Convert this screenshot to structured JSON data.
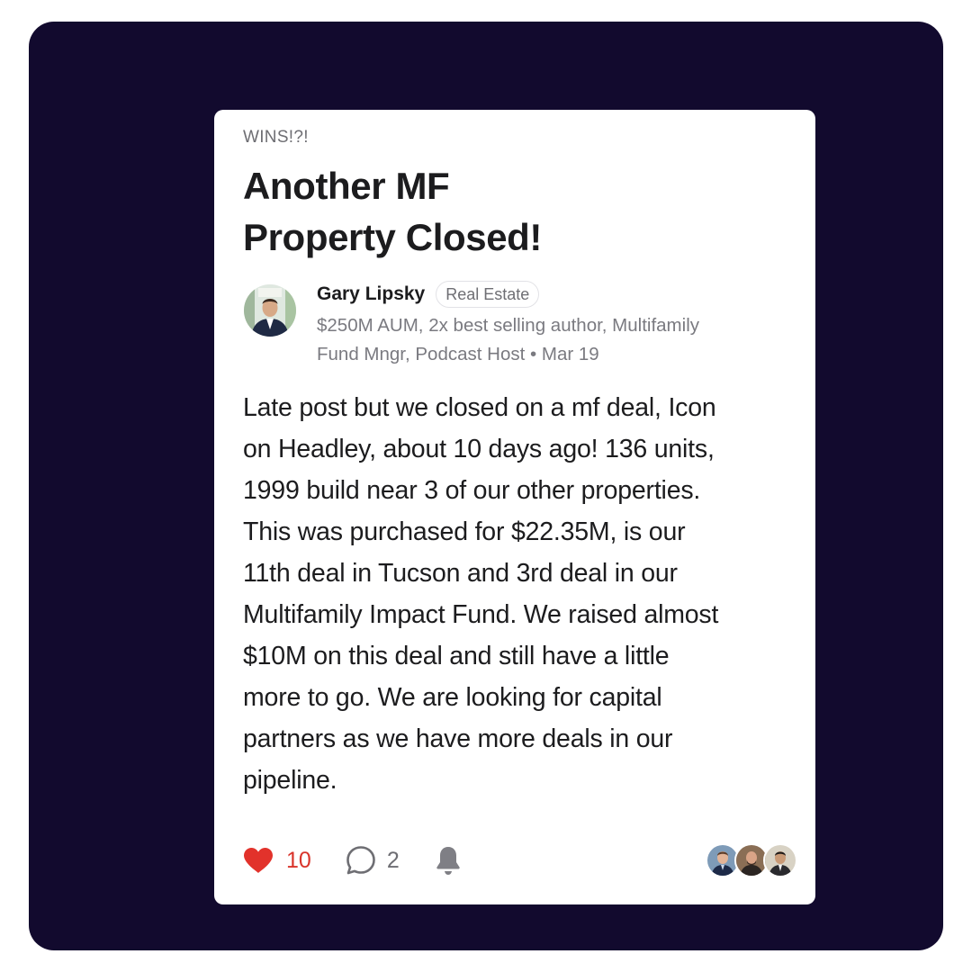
{
  "post": {
    "category": "WINS!?!",
    "title_line1": "Another MF",
    "title_line2": "Property Closed!",
    "author": {
      "name": "Gary Lipsky",
      "tag": "Real Estate",
      "bio_line1": "$250M AUM, 2x best selling author, Multifamily",
      "bio_line2": "Fund Mngr, Podcast Host",
      "separator": "•",
      "date": "Mar 19"
    },
    "body": [
      "Late post but we closed on a mf deal, Icon",
      "on Headley, about 10 days ago! 136 units,",
      "1999 build near 3 of our other properties.",
      "This was purchased for $22.35M, is our",
      "11th deal in Tucson and 3rd deal in our",
      "Multifamily Impact Fund. We raised almost",
      "$10M on this deal and still have a little",
      "more to go. We are looking for capital",
      "partners as we have more deals in our",
      "pipeline."
    ],
    "actions": {
      "likes": "10",
      "comments": "2",
      "like_icon": "heart-icon",
      "comment_icon": "comment-bubble-icon",
      "notify_icon": "bell-icon"
    }
  },
  "colors": {
    "frame_background": "#120a2e",
    "card_background": "#ffffff",
    "like_red": "#d9342b",
    "muted_text": "#6e6e73"
  }
}
